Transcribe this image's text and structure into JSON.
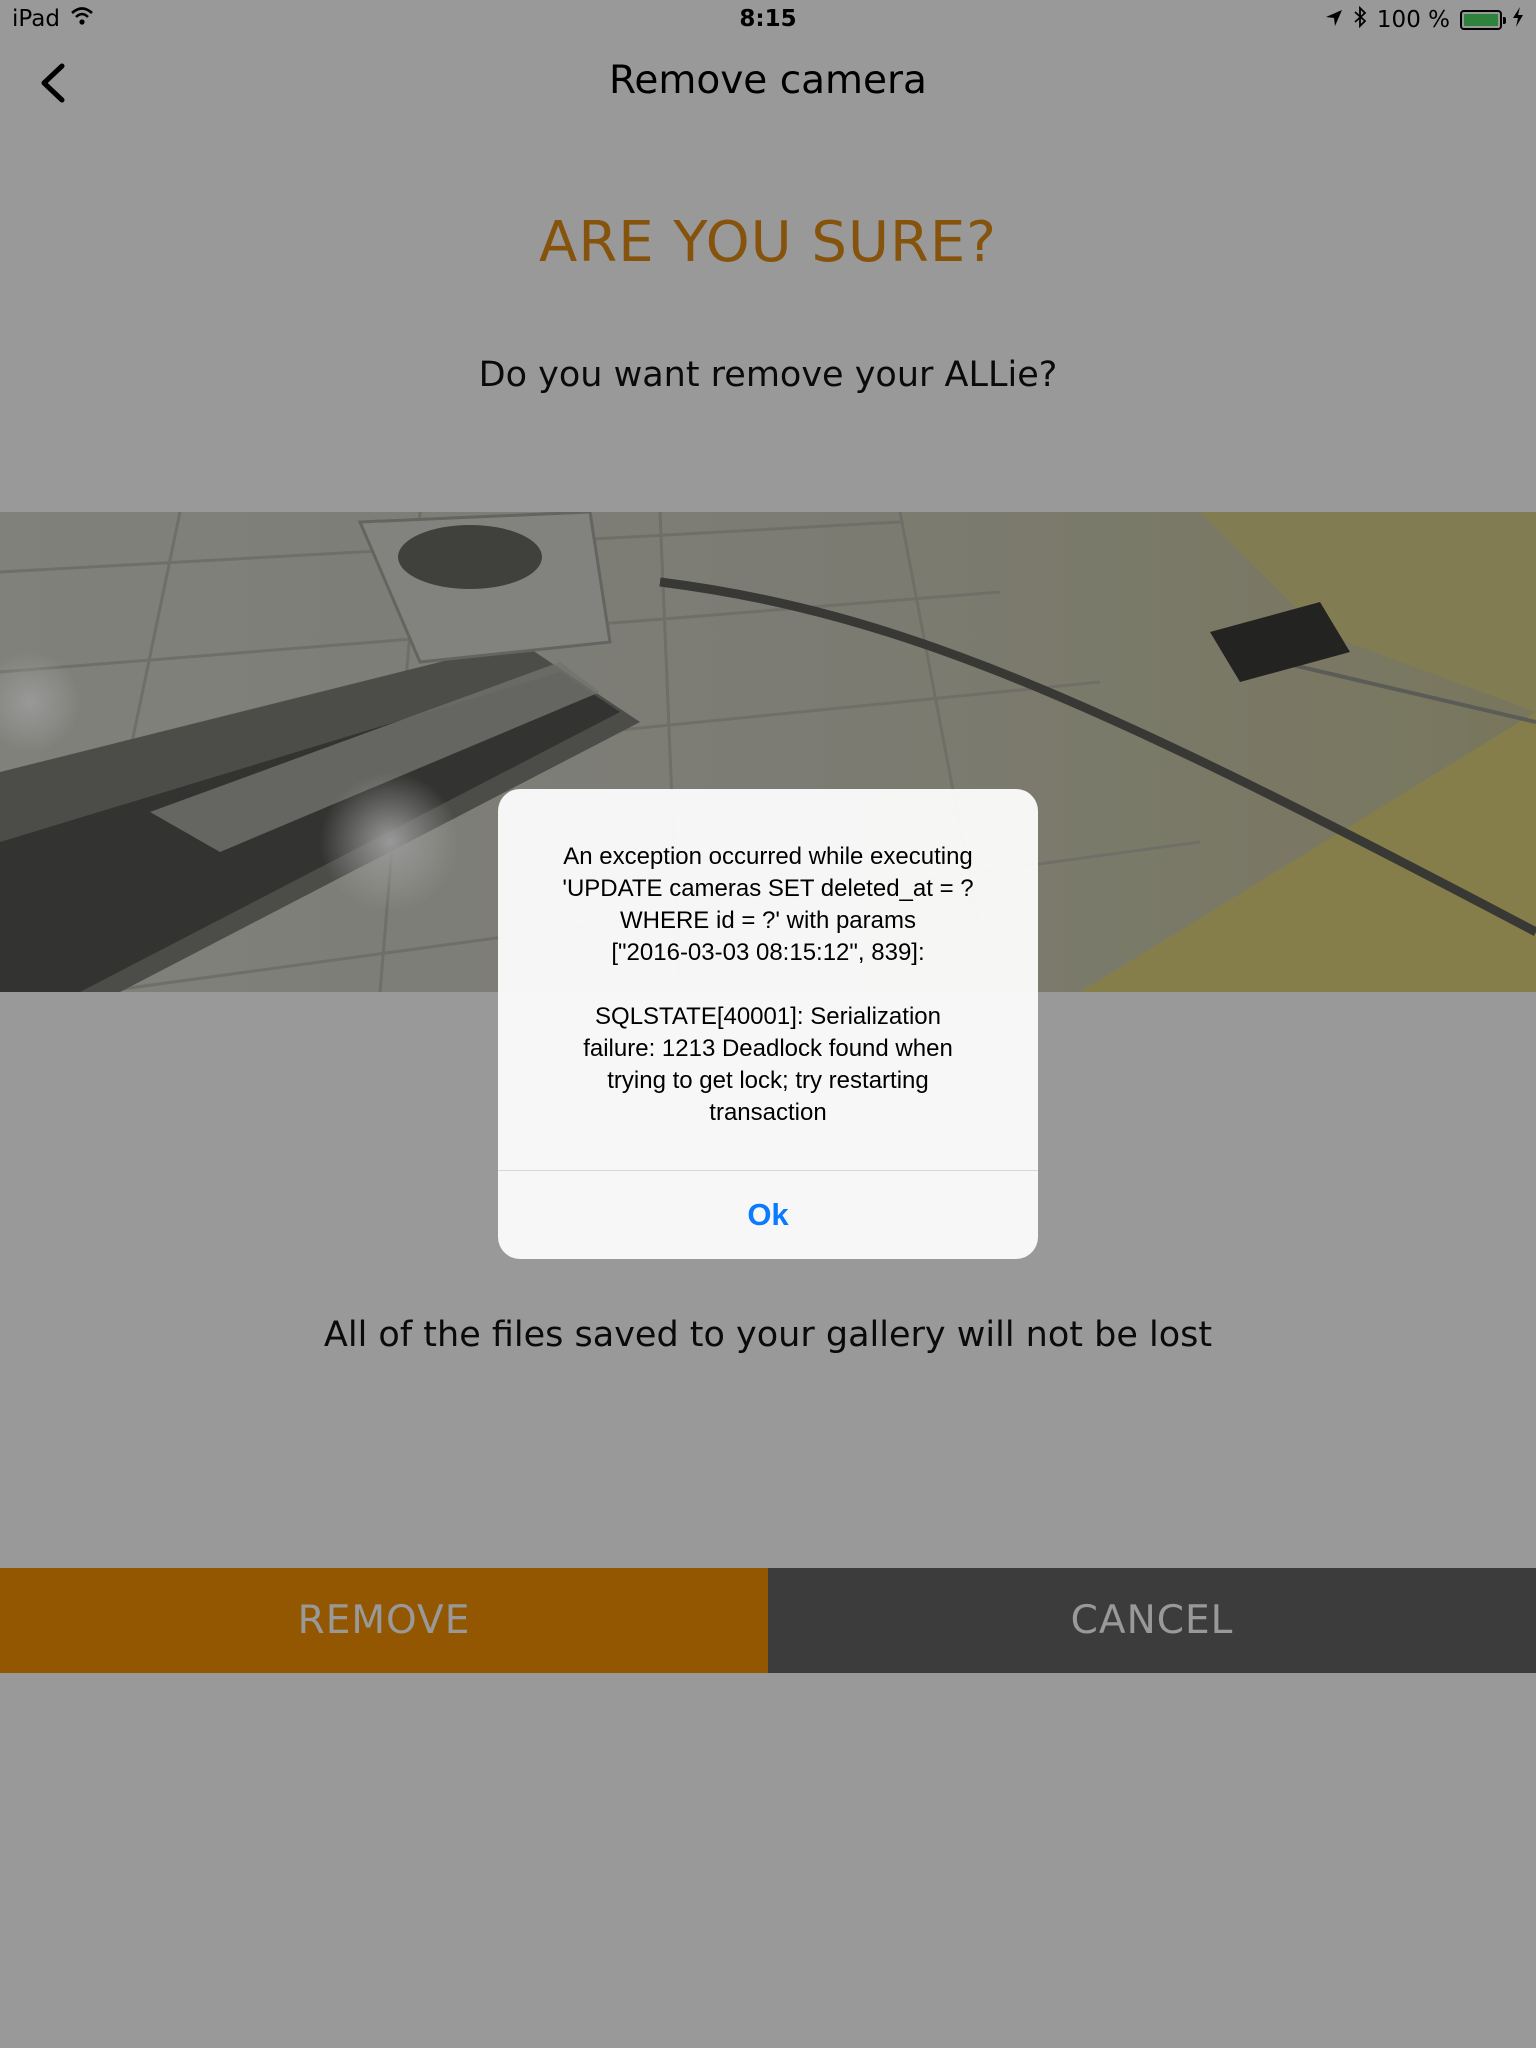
{
  "status_bar": {
    "device": "iPad",
    "time": "8:15",
    "battery_text": "100 %",
    "battery_level": 1.0,
    "battery_color": "#4cd964",
    "icons": [
      "wifi-icon",
      "location-arrow-icon",
      "bluetooth-icon",
      "battery-icon",
      "charging-bolt-icon"
    ]
  },
  "nav": {
    "title": "Remove camera",
    "back_icon": "chevron-left-icon"
  },
  "main": {
    "heading": "ARE YOU SURE?",
    "question": "Do you want remove your ALLie?",
    "gallery_note": "All of the files saved to your gallery will not be lost"
  },
  "buttons": {
    "remove": "REMOVE",
    "cancel": "CANCEL"
  },
  "alert": {
    "message": "An exception occurred while executing\n'UPDATE cameras SET deleted_at = ?\nWHERE id = ?' with params\n[\"2016-03-03 08:15:12\", 839]:\n\nSQLSTATE[40001]: Serialization\nfailure: 1213 Deadlock found when\ntrying to get lock; try restarting\ntransaction",
    "ok_label": "Ok"
  },
  "colors": {
    "accent": "#e08a14",
    "remove_bg": "#f39200",
    "cancel_bg": "#656565",
    "alert_action": "#0a7aff"
  }
}
